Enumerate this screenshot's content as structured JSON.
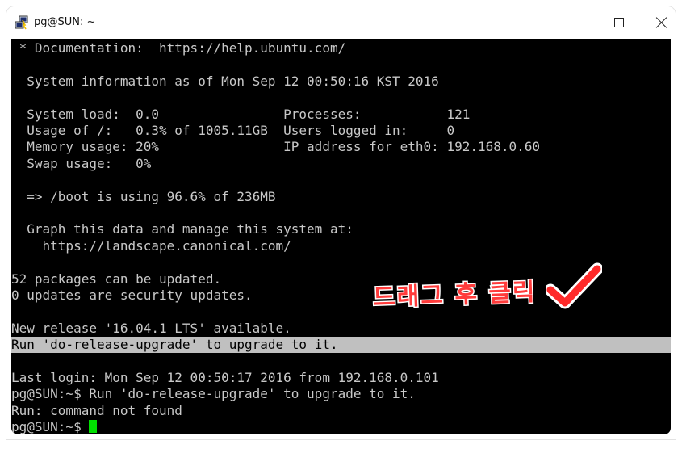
{
  "window": {
    "title": "pg@SUN: ~"
  },
  "icons": {
    "app": "putty-icon",
    "minimize": "minimize-icon",
    "maximize": "maximize-icon",
    "close": "close-icon",
    "check": "checkmark-icon"
  },
  "terminal": {
    "lines": [
      " * Documentation:  https://help.ubuntu.com/",
      "",
      "  System information as of Mon Sep 12 00:50:16 KST 2016",
      "",
      "  System load:  0.0                Processes:           121",
      "  Usage of /:   0.3% of 1005.11GB  Users logged in:     0",
      "  Memory usage: 20%                IP address for eth0: 192.168.0.60",
      "  Swap usage:   0%",
      "",
      "  => /boot is using 96.6% of 236MB",
      "",
      "  Graph this data and manage this system at:",
      "    https://landscape.canonical.com/",
      "",
      "52 packages can be updated.",
      "0 updates are security updates.",
      "",
      "New release '16.04.1 LTS' available.",
      "Run 'do-release-upgrade' to upgrade to it.",
      "",
      "Last login: Mon Sep 12 00:50:17 2016 from 192.168.0.101",
      "pg@SUN:~$ Run 'do-release-upgrade' to upgrade to it.",
      "Run: command not found",
      "pg@SUN:~$ "
    ],
    "selected_line_index": 18
  },
  "colors": {
    "terminal_bg": "#000000",
    "terminal_fg": "#c8c8c8",
    "selection_bg": "#c0c0c0",
    "cursor": "#00e000",
    "annotation": "#ff3b3b"
  },
  "annotation": {
    "text": "드래그 후 클릭"
  }
}
